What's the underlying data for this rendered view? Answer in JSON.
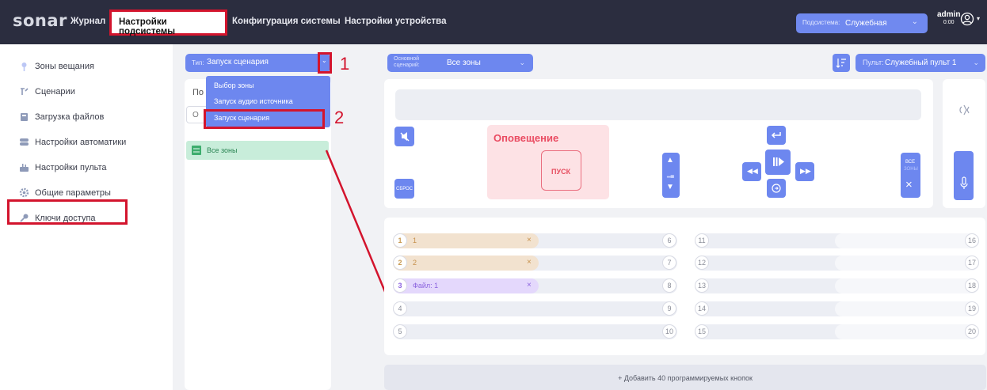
{
  "app": {
    "logo": "sonar"
  },
  "nav": {
    "items": [
      {
        "label": "Журнал"
      },
      {
        "label": "Настройки подсистемы"
      },
      {
        "label": "Конфигурация системы"
      },
      {
        "label": "Настройки устройства"
      }
    ]
  },
  "subsystem": {
    "label": "Подсистема:",
    "value": "Служебная"
  },
  "user": {
    "name": "admin",
    "time": "0:00"
  },
  "sidebar": {
    "items": [
      {
        "label": "Зоны вещания",
        "icon": "broadcast-icon"
      },
      {
        "label": "Сценарии",
        "icon": "scenario-icon"
      },
      {
        "label": "Загрузка файлов",
        "icon": "file-upload-icon"
      },
      {
        "label": "Настройки автоматики",
        "icon": "automation-icon"
      },
      {
        "label": "Настройки пульта",
        "icon": "remote-icon"
      },
      {
        "label": "Общие параметры",
        "icon": "gear-icon"
      },
      {
        "label": "Ключи доступа",
        "icon": "key-icon"
      }
    ]
  },
  "type_select": {
    "label": "Тип:",
    "value": "Запуск сценария"
  },
  "dropdown": {
    "options": [
      "Выбор зоны",
      "Запуск аудио источника",
      "Запуск сценария"
    ]
  },
  "left_panel": {
    "partial_1": "По",
    "partial_2": "О",
    "all_zones": "Все зоны"
  },
  "annotations": [
    "1",
    "2"
  ],
  "main_scenario": {
    "label_line1": "Основной",
    "label_line2": "сценарий:",
    "value": "Все зоны"
  },
  "remote": {
    "label": "Пульт:",
    "value": "Служебный пульт 1"
  },
  "controls": {
    "reset": "СБРОС",
    "alert_title": "Оповещение",
    "start": "ПУСК",
    "all_zones_top": "ВСЕ",
    "all_zones_bottom": "ЗОНЫ"
  },
  "zones": {
    "left_col": [
      {
        "num": "1",
        "label": "1",
        "kind": "audio"
      },
      {
        "num": "2",
        "label": "2",
        "kind": "audio"
      },
      {
        "num": "3",
        "label": "Файл: 1",
        "kind": "file"
      },
      {
        "num": "4",
        "label": ""
      },
      {
        "num": "5",
        "label": ""
      }
    ],
    "mid_nums": [
      "6",
      "7",
      "8",
      "9",
      "10"
    ],
    "right_col": [
      "11",
      "12",
      "13",
      "14",
      "15"
    ],
    "far_nums": [
      "16",
      "17",
      "18",
      "19",
      "20"
    ]
  },
  "add_button": "+ Добавить 40 программируемых кнопок"
}
